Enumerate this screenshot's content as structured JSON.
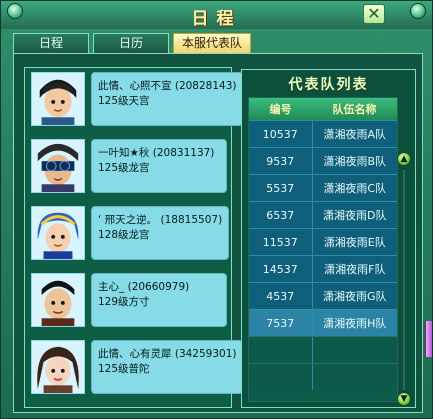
{
  "window": {
    "title": "日程",
    "close_glyph": "✕"
  },
  "tabs": [
    {
      "label": "日程",
      "active": false
    },
    {
      "label": "日历",
      "active": false
    },
    {
      "label": "本服代表队",
      "active": true
    }
  ],
  "members": [
    {
      "name": "此情、心照不宣",
      "id": "(20828143)",
      "detail": "125级天宫",
      "avatar": "black-hair-boy-avatar"
    },
    {
      "name": "一叶知★秋",
      "id": "(20831137)",
      "detail": "125级龙宫",
      "avatar": "masked-boy-avatar"
    },
    {
      "name": "‘ 邢天之逆。",
      "id": "(18815507)",
      "detail": "128级龙宫",
      "avatar": "blue-hair-avatar"
    },
    {
      "name": "主心_",
      "id": "(20660979)",
      "detail": "129级方寸",
      "avatar": "black-hair-man-avatar"
    },
    {
      "name": "此情、心有灵犀",
      "id": "(34259301)",
      "detail": "125级普陀",
      "avatar": "long-hair-girl-avatar"
    }
  ],
  "team_list": {
    "title": "代表队列表",
    "columns": {
      "id": "编号",
      "name": "队伍名称"
    },
    "rows": [
      {
        "id": "10537",
        "name": "潇湘夜雨A队",
        "selected": false
      },
      {
        "id": "9537",
        "name": "潇湘夜雨B队",
        "selected": false
      },
      {
        "id": "5537",
        "name": "潇湘夜雨C队",
        "selected": false
      },
      {
        "id": "6537",
        "name": "潇湘夜雨D队",
        "selected": false
      },
      {
        "id": "11537",
        "name": "潇湘夜雨E队",
        "selected": false
      },
      {
        "id": "14537",
        "name": "潇湘夜雨F队",
        "selected": false
      },
      {
        "id": "4537",
        "name": "潇湘夜雨G队",
        "selected": false
      },
      {
        "id": "7537",
        "name": "潇湘夜雨H队",
        "selected": true
      }
    ],
    "scroll_up_glyph": "▲",
    "scroll_down_glyph": "▼"
  },
  "colors": {
    "accent": "#f2d36f",
    "panel": "#115240",
    "row": "#0f5f7a",
    "row_selected": "#2b83a6",
    "info_box": "#86dbe6"
  }
}
